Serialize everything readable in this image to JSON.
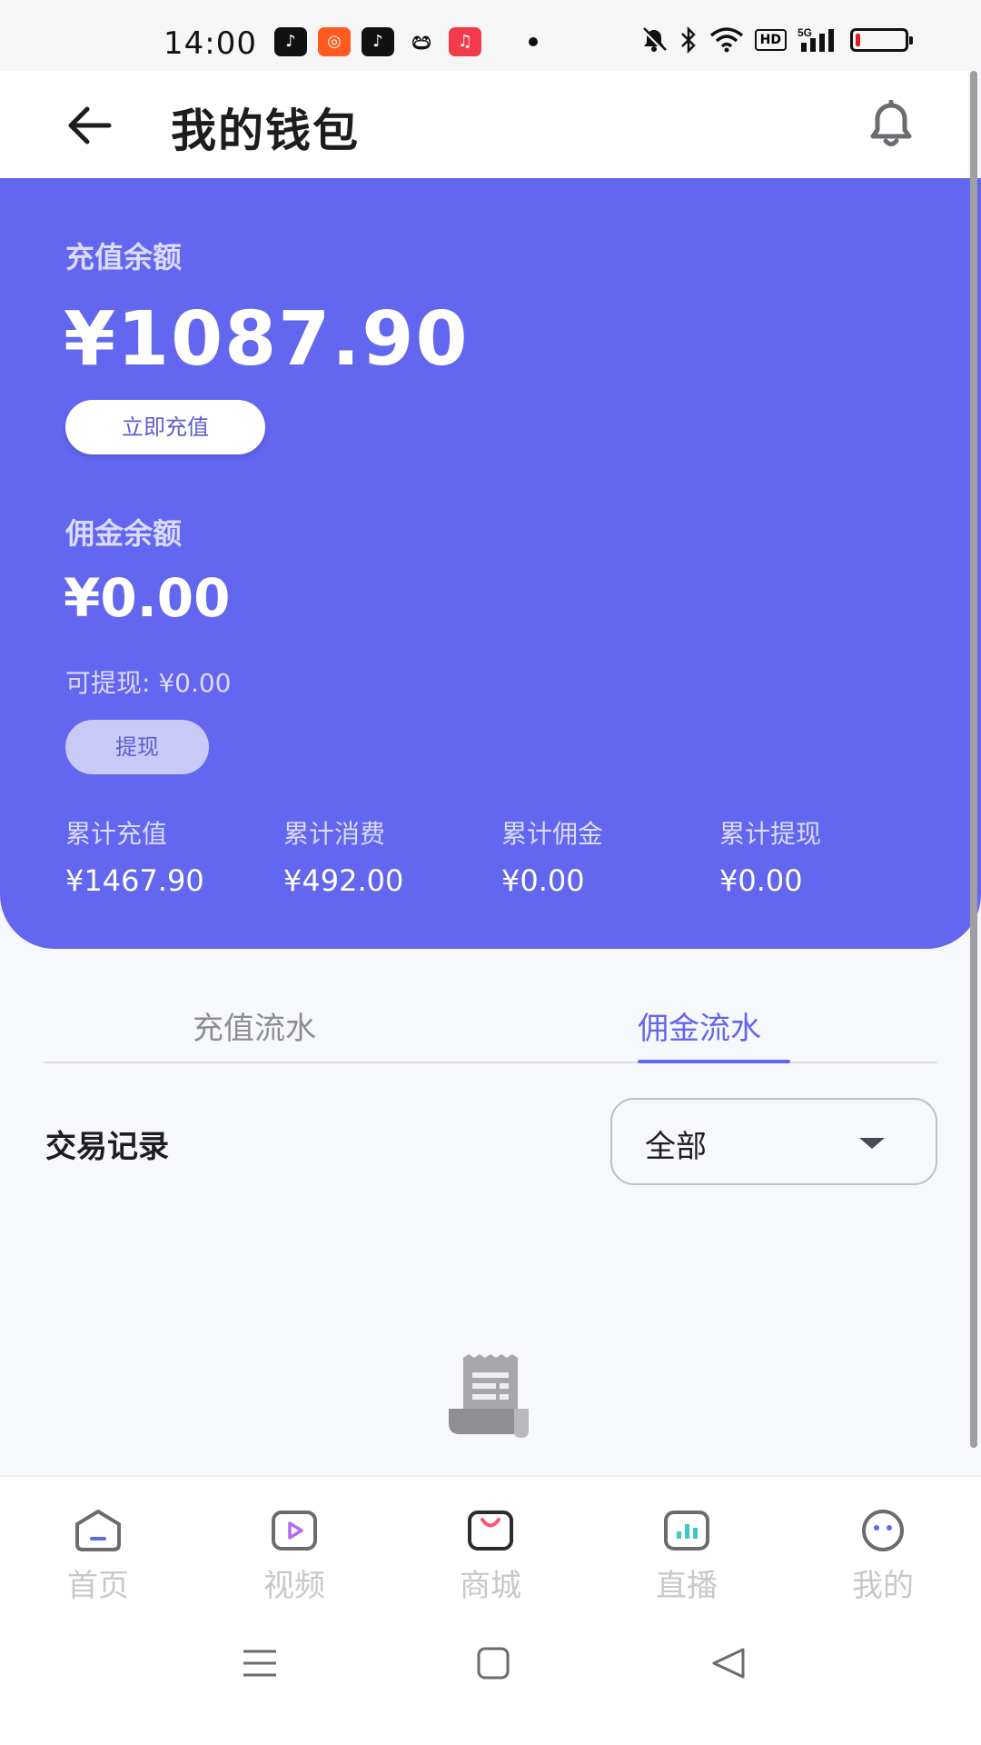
{
  "status_bar": {
    "time": "14:00",
    "app_icons": [
      "douyin-icon",
      "kuaishou-icon",
      "douyin-icon",
      "wechat-icon",
      "music-icon"
    ],
    "right_icons": [
      "mute-bell-icon",
      "bluetooth-icon",
      "wifi-icon",
      "hd-icon",
      "signal-5g-icon",
      "battery-icon"
    ],
    "hd_label": "HD",
    "network_label": "5G",
    "battery_level": 0.1,
    "battery_color": "#e21b1b"
  },
  "header": {
    "title": "我的钱包"
  },
  "wallet": {
    "accent_color": "#6366ee",
    "recharge_label": "充值余额",
    "recharge_amount": "¥1087.90",
    "recharge_button": "立即充值",
    "commission_label": "佣金余额",
    "commission_amount": "¥0.00",
    "withdrawable_text": "可提现: ¥0.00",
    "withdraw_button": "提现",
    "stats": [
      {
        "label": "累计充值",
        "value": "¥1467.90"
      },
      {
        "label": "累计消费",
        "value": "¥492.00"
      },
      {
        "label": "累计佣金",
        "value": "¥0.00"
      },
      {
        "label": "累计提现",
        "value": "¥0.00"
      }
    ]
  },
  "tabs": [
    {
      "label": "充值流水",
      "active": false
    },
    {
      "label": "佣金流水",
      "active": true
    }
  ],
  "records": {
    "title": "交易记录",
    "filter_value": "全部"
  },
  "empty_state": {
    "icon": "receipt-icon"
  },
  "bottom_nav": [
    {
      "label": "首页",
      "icon": "home-icon"
    },
    {
      "label": "视频",
      "icon": "video-icon"
    },
    {
      "label": "商城",
      "icon": "mall-icon"
    },
    {
      "label": "直播",
      "icon": "live-icon"
    },
    {
      "label": "我的",
      "icon": "profile-icon"
    }
  ],
  "system_nav": [
    "menu-icon",
    "home-square-icon",
    "back-triangle-icon"
  ]
}
